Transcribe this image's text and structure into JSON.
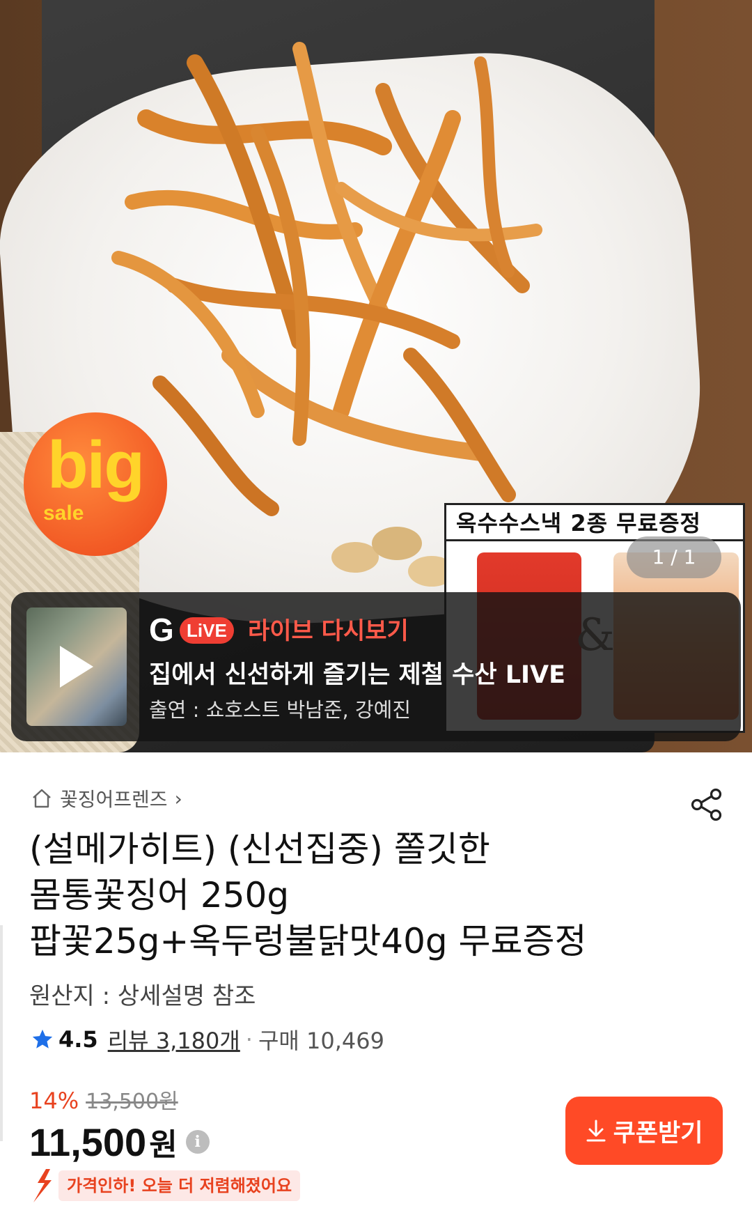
{
  "hero": {
    "badge_big": "big",
    "badge_sale": "sale",
    "promo_title": "옥수수스낵 2종 무료증정",
    "page_indicator": "1 / 1"
  },
  "live": {
    "logo_g": "G",
    "logo_live": "LiVE",
    "replay_label": "라이브 다시보기",
    "title": "집에서 신선하게 즐기는 제철 수산 LIVE",
    "host": "출연 : 쇼호스트 박남준, 강예진"
  },
  "breadcrumb": {
    "store": "꽃징어프렌즈",
    "chevron": "›"
  },
  "product": {
    "title_line1": "(설메가히트) (신선집중) 쫄깃한",
    "title_line2": "몸통꽃징어 250g",
    "title_line3": "팝꽃25g+옥두렁불닭맛40g 무료증정",
    "origin": "원산지 : 상세설명 참조"
  },
  "rating": {
    "score": "4.5",
    "review": "리뷰 3,180개",
    "dot": "·",
    "purchase": "구매 10,469"
  },
  "price": {
    "discount_pct": "14%",
    "original": "13,500원",
    "final": "11,500",
    "currency": "원",
    "info": "i"
  },
  "coupon": {
    "label": "쿠폰받기"
  },
  "price_drop": {
    "label": "가격인하! 오늘 더 저렴해졌어요"
  },
  "colors": {
    "accent": "#ff4a26",
    "discount": "#e8421f",
    "star": "#1e6fe8",
    "live_red": "#ef3e33"
  },
  "icons": [
    "home-icon",
    "chevron-right-icon",
    "share-icon",
    "star-icon",
    "info-icon",
    "download-icon",
    "price-drop-arrow-icon",
    "play-icon"
  ]
}
